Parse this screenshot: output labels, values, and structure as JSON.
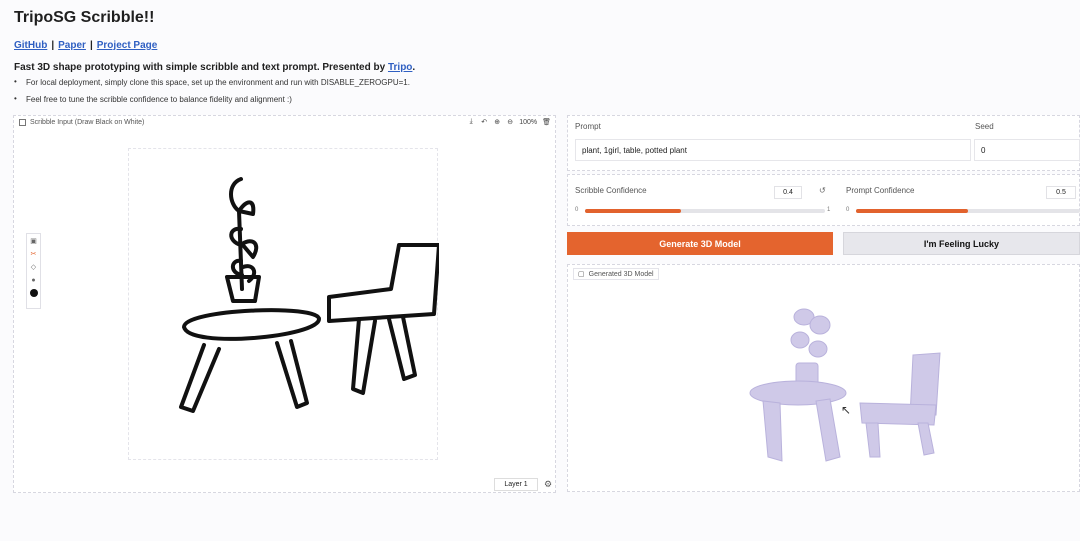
{
  "header": {
    "title": "TripoSG Scribble!!",
    "links": [
      "GitHub",
      "Paper",
      "Project Page"
    ],
    "desc_prefix": "Fast 3D shape prototyping with simple scribble and text prompt. Presented by ",
    "desc_link": "Tripo",
    "desc_suffix": ".",
    "bullets": [
      "For local deployment, simply clone this space, set up the environment and run with DISABLE_ZEROGPU=1.",
      "Feel free to tune the scribble confidence to balance fidelity and alignment :)"
    ]
  },
  "scribble": {
    "label": "Scribble Input (Draw Black on White)",
    "zoom": "100%",
    "layer": "Layer 1"
  },
  "inputs": {
    "prompt_label": "Prompt",
    "prompt_value": "plant, 1girl, table, potted plant",
    "seed_label": "Seed",
    "seed_value": "0"
  },
  "sliders": {
    "scribble_label": "Scribble Confidence",
    "scribble_value": "0.4",
    "scribble_fraction": 0.4,
    "scribble_min": "0",
    "scribble_max": "1",
    "prompt_label": "Prompt Confidence",
    "prompt_value": "0.5",
    "prompt_fraction": 0.5,
    "prompt_min": "0"
  },
  "buttons": {
    "generate": "Generate 3D Model",
    "lucky": "I'm Feeling Lucky"
  },
  "model": {
    "label": "Generated 3D Model"
  },
  "colors": {
    "accent": "#e4642e",
    "model_tint": "#c9c3e6"
  }
}
